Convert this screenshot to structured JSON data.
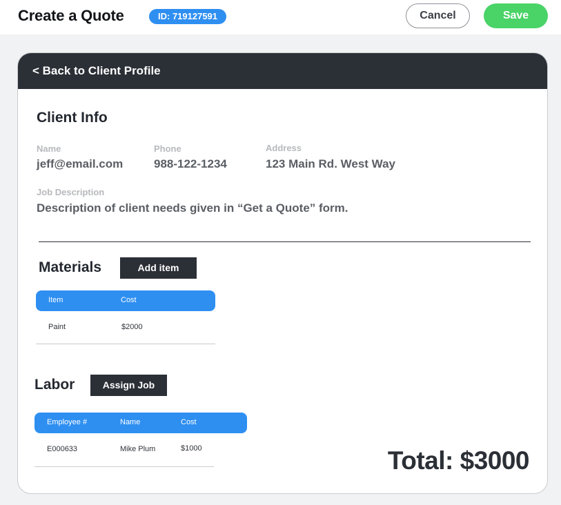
{
  "header": {
    "title": "Create a Quote",
    "id_badge": "ID: 719127591",
    "cancel_label": "Cancel",
    "save_label": "Save"
  },
  "card": {
    "back_label": "< Back to Client Profile",
    "client_info": {
      "title": "Client Info",
      "name_label": "Name",
      "name_value": "jeff@email.com",
      "phone_label": "Phone",
      "phone_value": "988-122-1234",
      "address_label": "Address",
      "address_value": "123 Main Rd. West Way",
      "job_label": "Job Description",
      "job_value": "Description of client needs given in “Get a Quote” form."
    },
    "materials": {
      "title": "Materials",
      "add_label": "Add item",
      "columns": [
        "Item",
        "Cost"
      ],
      "rows": [
        [
          "Paint",
          "$2000"
        ]
      ]
    },
    "labor": {
      "title": "Labor",
      "assign_label": "Assign Job",
      "columns": [
        "Employee #",
        "Name",
        "Cost"
      ],
      "rows": [
        [
          "E000633",
          "Mike Plum",
          "$1000"
        ]
      ]
    },
    "total": "Total: $3000"
  },
  "colors": {
    "accent_blue": "#2e8ff1",
    "save_green": "#4ad367",
    "dark": "#2b2f36"
  }
}
